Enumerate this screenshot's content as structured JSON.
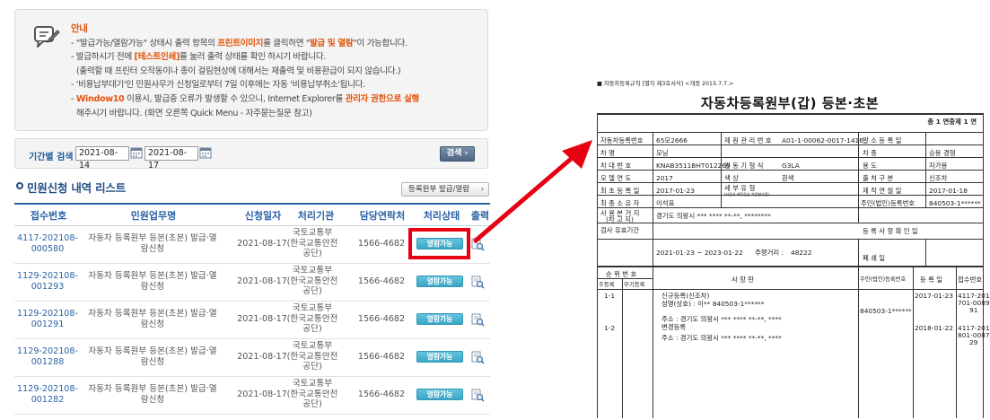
{
  "notice": {
    "title": "안내",
    "lines": [
      [
        "- \"발급가능/열람가능\" 상태시 출력 항목의 ",
        "프린트이미지",
        "를 클릭하면 \"",
        "발급 및 열람",
        "\"이 가능합니다."
      ],
      [
        "- 발급하시기 전에 ",
        "[테스트인쇄]",
        "를 눌러 출력 상태를 확인 하시기 바랍니다."
      ],
      [
        "(출력할 때 프린터 오작동이나 종이 걸림현상에 대해서는 재출력 및 비용환급이 되지 않습니다.)"
      ],
      [
        "- '비용납부대기'인 민원사무가 신청일로부터 7일 이후에는 자동 '비용납부취소'됩니다."
      ],
      [
        "- ",
        "Window10",
        " 이용시, 발급중 오류가 발생할 수 있으니, Internet Explorer를 ",
        "관리자 권한으로 실행"
      ],
      [
        "해주시기 바랍니다. (화면 오른쪽 Quick Menu - 자주묻는질문 참고)"
      ]
    ]
  },
  "search": {
    "label": "기간별 검색 :",
    "date_from": "2021-08-14",
    "date_to": "2021-08-17",
    "separator": "~",
    "button": "검색 ›"
  },
  "list": {
    "title": "민원신청 내역 리스트",
    "register_button": "등록원부 발급/열람",
    "register_button_arrow": "›",
    "columns": [
      "접수번호",
      "민원업무명",
      "신청일자",
      "처리기관",
      "담당연락처",
      "처리상태",
      "출력"
    ],
    "rows": [
      {
        "no1": "4117-202108-",
        "no2": "000580",
        "task1": "자동차 등록원부 등본(초본) 발급·열",
        "task2": "람신청",
        "date": "2021-08-17",
        "agency1": "국토교통부",
        "agency2": "(한국교통안전",
        "agency3": "공단)",
        "phone": "1566-4682",
        "status": "열람가능"
      },
      {
        "no1": "1129-202108-",
        "no2": "001293",
        "task1": "자동차 등록원부 등본(초본) 발급·열",
        "task2": "람신청",
        "date": "2021-08-17",
        "agency1": "국토교통부",
        "agency2": "(한국교통안전",
        "agency3": "공단)",
        "phone": "1566-4682",
        "status": "열람가능"
      },
      {
        "no1": "1129-202108-",
        "no2": "001291",
        "task1": "자동차 등록원부 등본(초본) 발급·열",
        "task2": "람신청",
        "date": "2021-08-17",
        "agency1": "국토교통부",
        "agency2": "(한국교통안전",
        "agency3": "공단)",
        "phone": "1566-4682",
        "status": "열람가능"
      },
      {
        "no1": "1129-202108-",
        "no2": "001288",
        "task1": "자동차 등록원부 등본(초본) 발급·열",
        "task2": "람신청",
        "date": "2021-08-17",
        "agency1": "국토교통부",
        "agency2": "(한국교통안전",
        "agency3": "공단)",
        "phone": "1566-4682",
        "status": "열람가능"
      },
      {
        "no1": "1129-202108-",
        "no2": "001282",
        "task1": "자동차 등록원부 등본(초본) 발급·열",
        "task2": "람신청",
        "date": "2021-08-17",
        "agency1": "국토교통부",
        "agency2": "(한국교통안전",
        "agency3": "공단)",
        "phone": "1566-4682",
        "status": "열람가능"
      }
    ]
  },
  "colors": {
    "accent_blue": "#2a62a6",
    "orange": "#e2540a",
    "highlight_red": "#e60012",
    "status_button": "#3aa6c6"
  },
  "icons": {
    "notice": "pencil-note-icon",
    "calendar": "calendar-icon",
    "print": "print-preview-icon"
  },
  "document": {
    "caption": "■ 자동차등록규칙 [별지 제3호서식] <개정 2015.7.7.>",
    "title": "자동차등록원부(갑) 등본·초본",
    "page": "총  1  면중제  1  면",
    "fields": {
      "reg_no_label": "자동차등록번호",
      "reg_no": "65모2666",
      "mgmt_no_label": "제 원 관 리 번 호",
      "mgmt_no": "A01-1-00062-0017-1416",
      "cancel_date_label": "말  소  등  록  일",
      "car_name_label": "차          명",
      "car_name": "모닝",
      "car_type_label": "차          종",
      "car_type": "승용 경형",
      "vin_label": "차 대 번 호",
      "vin": "KNAB3511BHT012269",
      "engine_label": "원 동 기 형 식",
      "engine": "G3LA",
      "use_label": "용          도",
      "use": "자가용",
      "model_year_label": "모 델 연 도",
      "model_year": "2017",
      "color_label": "색          상",
      "color": "흰색",
      "origin_label": "출  처  구  분",
      "origin": "신조차",
      "first_reg_label": "최 초 등 록 일",
      "first_reg": "2017-01-23",
      "cert_type_label": "세  부  유  형",
      "cert_type_sub": "(자동차 제작증상 차량형식명)",
      "manufacture_label": "제 작 연 월 일",
      "manufacture": "2017-01-18",
      "owner_label": "최 종 소 유 자",
      "owner": "이석표",
      "id_label": "주민(법인)등록번호",
      "id": "840503-1******",
      "address_label": "사 용 본 거 지",
      "address_label2": "(차 고 지)",
      "address": "경기도 의왕시 *** **** **-**, ********",
      "inspect_label": "검사 유효기간",
      "inspect": "2021-01-23 ~ 2023-01-22",
      "mileage_label": "주행거리 : ",
      "mileage": "48222",
      "reg_confirm_label": "등 록 사 항 확 인 일",
      "close_label": "폐          쇄          일"
    },
    "history_header": {
      "order": "순 위 번 호",
      "main": "주등록",
      "sub": "부기등록",
      "content": "사          항          란",
      "id": "주민(법인)등록번호",
      "date": "등 록 일",
      "receipt": "접수번호"
    },
    "history": [
      {
        "order": "1-1",
        "line1": "신규등록(신조차)",
        "line2": "성명(상호) : 이**  840503-1******",
        "line3": "주소 : 경기도 의왕시 *** **** **-**, ****",
        "id": "840503-1******",
        "date": "2017-01-23",
        "r1": "4117-201",
        "r2": "701-0089",
        "r3": "91"
      },
      {
        "order": "1-2",
        "line1": "변경등록",
        "line2": "주소 : 경기도 의왕시 *** **** **-**, ****",
        "line3": "",
        "id": "",
        "date": "2018-01-22",
        "r1": "4117-201",
        "r2": "801-0087",
        "r3": "29"
      }
    ]
  }
}
